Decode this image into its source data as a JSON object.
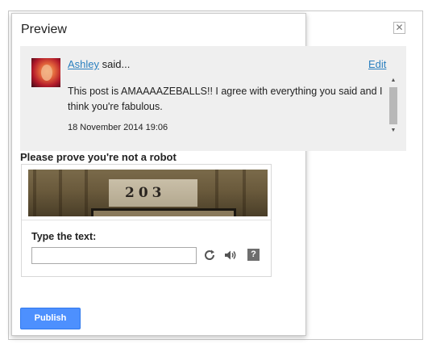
{
  "dialog": {
    "title": "Preview",
    "close_glyph": "✕"
  },
  "comment": {
    "author": "Ashley",
    "said": " said...",
    "edit_label": "Edit",
    "text": "This post is AMAAAAZEBALLS!! I agree with everything you said and I think you're fabulous.",
    "date": "18 November 2014 19:06",
    "scroll_up_glyph": "▲",
    "scroll_down_glyph": "▼"
  },
  "captcha": {
    "heading": "Please prove you're not a robot",
    "image_text": "203",
    "type_label": "Type the text:",
    "input_value": "",
    "help_glyph": "?"
  },
  "actions": {
    "publish_label": "Publish"
  },
  "colors": {
    "accent": "#4d90fe",
    "link": "#2a7fbf",
    "comment_bg": "#efefef"
  },
  "icons": {
    "close": "close-icon",
    "refresh": "refresh-icon",
    "audio": "speaker-icon",
    "help": "help-icon",
    "avatar": "avatar"
  }
}
